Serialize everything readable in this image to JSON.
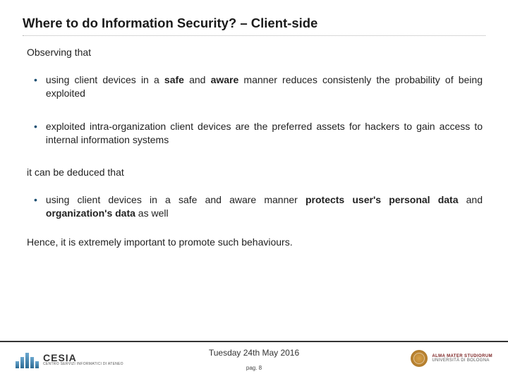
{
  "title": "Where to do Information Security? – Client-side",
  "lead": "Observing that",
  "bullets": {
    "b1_pre": "using client devices in a ",
    "b1_bold1": "safe",
    "b1_mid": " and ",
    "b1_bold2": "aware",
    "b1_post": " manner reduces consistenly the probability of being exploited",
    "b2": "exploited intra-organization client devices are the preferred assets for hackers to gain access to internal information systems",
    "b3_pre": "using client devices in a safe and aware manner ",
    "b3_bold1": "protects user's personal data",
    "b3_mid2": " and ",
    "b3_bold2": "organization's data",
    "b3_post": " as well"
  },
  "mid": "it can be deduced that",
  "closing": "Hence, it is extremely important to promote such behaviours.",
  "footer": {
    "date": "Tuesday 24th May 2016",
    "pag": "pag. 8"
  },
  "logos": {
    "left_name": "CESIA",
    "left_sub": "CENTRO SERVIZI INFORMATICI DI ATENEO",
    "right_l1": "ALMA MATER STUDIORUM",
    "right_l2": "UNIVERSITÀ DI BOLOGNA"
  }
}
